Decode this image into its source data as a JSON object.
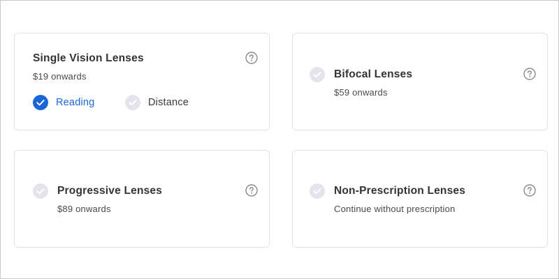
{
  "cards": {
    "single": {
      "title": "Single Vision Lenses",
      "subtitle": "$19 onwards",
      "selected": true,
      "options": [
        {
          "label": "Reading",
          "selected": true
        },
        {
          "label": "Distance",
          "selected": false
        }
      ]
    },
    "bifocal": {
      "title": "Bifocal Lenses",
      "subtitle": "$59 onwards",
      "selected": false
    },
    "progressive": {
      "title": "Progressive Lenses",
      "subtitle": "$89 onwards",
      "selected": false
    },
    "nonrx": {
      "title": "Non-Prescription Lenses",
      "subtitle": "Continue without prescription",
      "selected": false
    }
  },
  "icons": {
    "help": "question-circle-icon",
    "check_selected": "check-circle-filled-icon",
    "check_unselected": "check-circle-outline-icon"
  },
  "colors": {
    "accent": "#1a66d9",
    "check_inactive_bg": "#e4e5ec",
    "check_inactive_mark": "#ffffff",
    "help_icon": "#8a8a8a",
    "card_border": "#e2e2e6"
  }
}
